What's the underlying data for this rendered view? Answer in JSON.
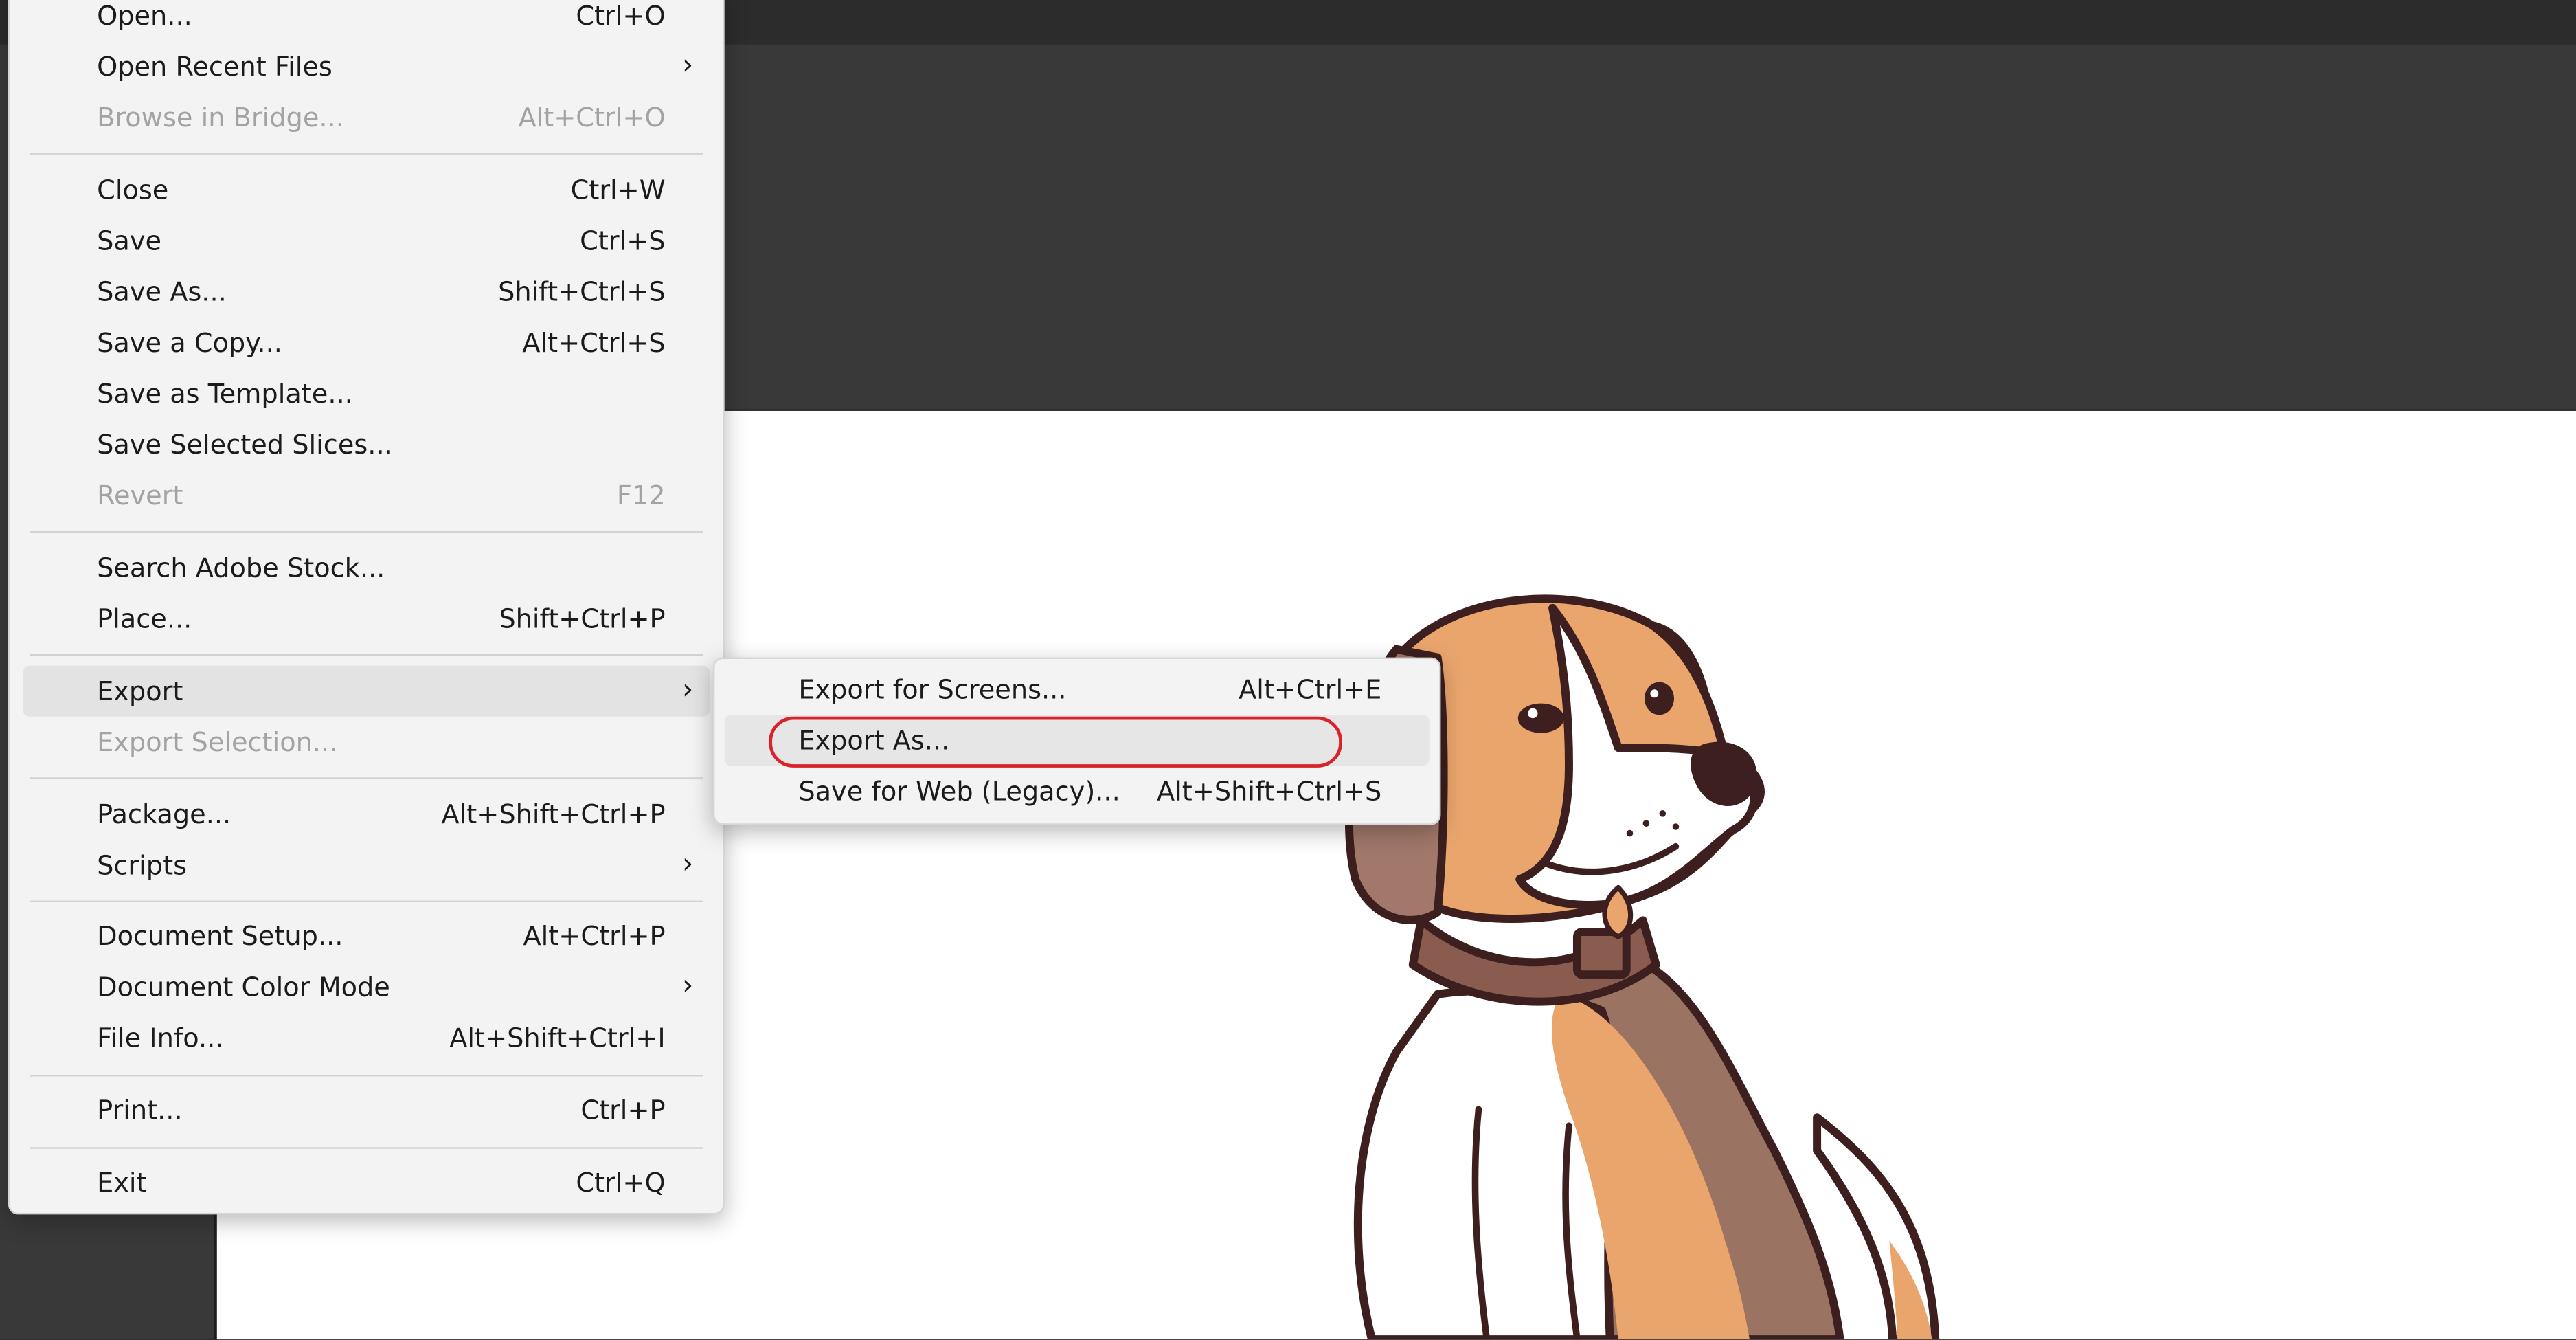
{
  "file_menu": {
    "items": [
      {
        "label": "Open...",
        "shortcut": "Ctrl+O"
      },
      {
        "label": "Open Recent Files",
        "shortcut": ""
      },
      {
        "label": "Browse in Bridge...",
        "shortcut": "Alt+Ctrl+O"
      },
      {
        "label": "Close",
        "shortcut": "Ctrl+W"
      },
      {
        "label": "Save",
        "shortcut": "Ctrl+S"
      },
      {
        "label": "Save As...",
        "shortcut": "Shift+Ctrl+S"
      },
      {
        "label": "Save a Copy...",
        "shortcut": "Alt+Ctrl+S"
      },
      {
        "label": "Save as Template...",
        "shortcut": ""
      },
      {
        "label": "Save Selected Slices...",
        "shortcut": ""
      },
      {
        "label": "Revert",
        "shortcut": "F12"
      },
      {
        "label": "Search Adobe Stock...",
        "shortcut": ""
      },
      {
        "label": "Place...",
        "shortcut": "Shift+Ctrl+P"
      },
      {
        "label": "Export",
        "shortcut": ""
      },
      {
        "label": "Export Selection...",
        "shortcut": ""
      },
      {
        "label": "Package...",
        "shortcut": "Alt+Shift+Ctrl+P"
      },
      {
        "label": "Scripts",
        "shortcut": ""
      },
      {
        "label": "Document Setup...",
        "shortcut": "Alt+Ctrl+P"
      },
      {
        "label": "Document Color Mode",
        "shortcut": ""
      },
      {
        "label": "File Info...",
        "shortcut": "Alt+Shift+Ctrl+I"
      },
      {
        "label": "Print...",
        "shortcut": "Ctrl+P"
      },
      {
        "label": "Exit",
        "shortcut": "Ctrl+Q"
      }
    ],
    "submenu_arrow": "›"
  },
  "export_submenu": {
    "items": [
      {
        "label": "Export for Screens...",
        "shortcut": "Alt+Ctrl+E"
      },
      {
        "label": "Export As...",
        "shortcut": ""
      },
      {
        "label": "Save for Web (Legacy)...",
        "shortcut": "Alt+Shift+Ctrl+S"
      }
    ]
  },
  "colors": {
    "menu_bg": "#f3f3f3",
    "annotation_ring": "#d8232a",
    "canvas": "#ffffff",
    "workspace": "#393939"
  }
}
